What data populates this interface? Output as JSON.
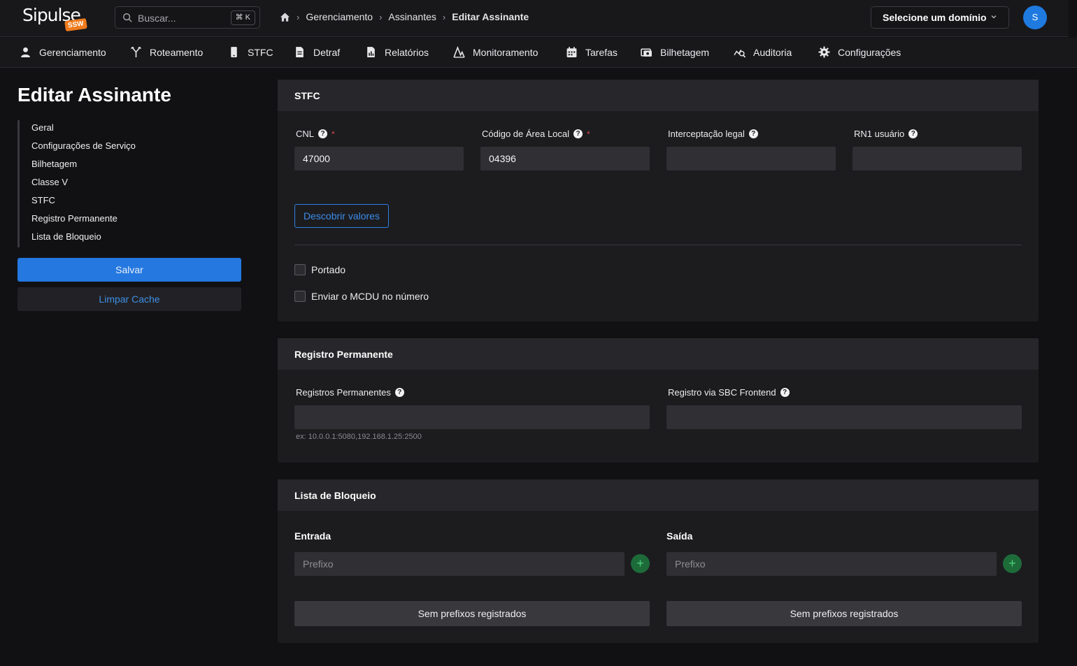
{
  "app": {
    "logo_text": "Sipulse",
    "logo_badge": "SSW"
  },
  "search": {
    "placeholder": "Buscar...",
    "shortcut": "⌘ K"
  },
  "breadcrumb": [
    "Gerenciamento",
    "Assinantes",
    "Editar Assinante"
  ],
  "domain_select": {
    "label": "Selecione um domínio"
  },
  "user": {
    "avatar_initial": "S"
  },
  "nav": [
    {
      "label": "Gerenciamento",
      "icon": "user-icon"
    },
    {
      "label": "Roteamento",
      "icon": "routing-icon"
    },
    {
      "label": "STFC",
      "icon": "phone-icon"
    },
    {
      "label": "Detraf",
      "icon": "document-icon"
    },
    {
      "label": "Relatórios",
      "icon": "report-icon"
    },
    {
      "label": "Monitoramento",
      "icon": "monitor-icon"
    },
    {
      "label": "Tarefas",
      "icon": "calendar-icon"
    },
    {
      "label": "Bilhetagem",
      "icon": "billing-icon"
    },
    {
      "label": "Auditoria",
      "icon": "audit-icon"
    },
    {
      "label": "Configurações",
      "icon": "gear-icon"
    }
  ],
  "page": {
    "title": "Editar Assinante"
  },
  "sidebar": {
    "links": [
      "Geral",
      "Configurações de Serviço",
      "Bilhetagem",
      "Classe V",
      "STFC",
      "Registro Permanente",
      "Lista de Bloqueio"
    ],
    "save_label": "Salvar",
    "cache_label": "Limpar Cache"
  },
  "stfc": {
    "title": "STFC",
    "cnl_label": "CNL",
    "cnl_value": "47000",
    "area_label": "Código de Área Local",
    "area_value": "04396",
    "intercept_label": "Interceptação legal",
    "intercept_value": "",
    "rn1_label": "RN1 usuário",
    "rn1_value": "",
    "required_mark": "*",
    "discover_label": "Descobrir valores",
    "ported_label": "Portado",
    "mcdu_label": "Enviar o MCDU no número"
  },
  "registro": {
    "title": "Registro Permanente",
    "perm_label": "Registros Permanentes",
    "perm_hint": "ex: 10.0.0.1:5080,192.168.1.25:2500",
    "sbc_label": "Registro via SBC Frontend"
  },
  "bloqueio": {
    "title": "Lista de Bloqueio",
    "in_label": "Entrada",
    "out_label": "Saída",
    "prefix_placeholder": "Prefixo",
    "empty_label": "Sem prefixos registrados"
  }
}
